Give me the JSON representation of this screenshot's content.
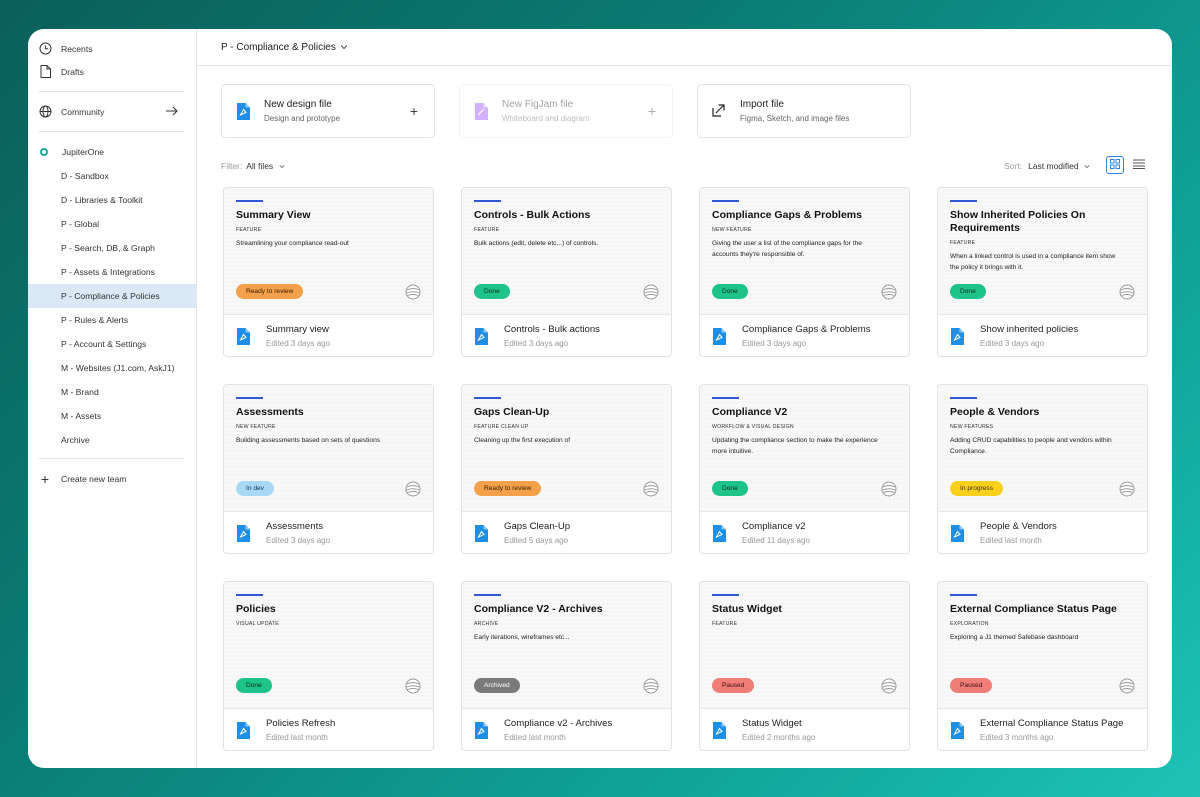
{
  "sidebar": {
    "recents": "Recents",
    "drafts": "Drafts",
    "community": "Community",
    "team": "JupiterOne",
    "projects": [
      "D - Sandbox",
      "D - Libraries & Toolkit",
      "P - Global",
      "P - Search, DB, & Graph",
      "P - Assets & Integrations",
      "P - Compliance & Policies",
      "P - Rules & Alerts",
      "P - Account & Settings",
      "M - Websites (J1.com, AskJ1)",
      "M - Brand",
      "M - Assets",
      "Archive"
    ],
    "active_project": "P - Compliance & Policies",
    "create_team": "Create new team"
  },
  "header": {
    "title": "P - Compliance & Policies"
  },
  "create": {
    "design": {
      "title": "New design file",
      "sub": "Design and prototype"
    },
    "figjam": {
      "title": "New FigJam file",
      "sub": "Whiteboard and diagram"
    },
    "import": {
      "title": "Import file",
      "sub": "Figma, Sketch, and image files"
    }
  },
  "filter": {
    "label": "Filter:",
    "value": "All files"
  },
  "sort": {
    "label": "Sort:",
    "value": "Last modified"
  },
  "colors": {
    "accent": "#2e86de",
    "brand_bar": "#3457d5",
    "ready_to_review": "#f5a04a",
    "done": "#1ec38a",
    "in_dev": "#a9d8f5",
    "in_progress": "#f9d11d",
    "archived": "#7a7a7a",
    "paused": "#f07d78",
    "file_icon": "#1f8fe5"
  },
  "files": [
    {
      "title": "Summary View",
      "tag": "FEATURE",
      "desc": "Streamlining your compliance read-out",
      "status": "Ready to review",
      "status_color": "#f5a04a",
      "status_text_color": "#3a2100",
      "name": "Summary view",
      "edited": "Edited 3 days ago"
    },
    {
      "title": "Controls - Bulk Actions",
      "tag": "FEATURE",
      "desc": "Bulk actions (edit, delete etc...) of controls.",
      "status": "Done",
      "status_color": "#1ec38a",
      "status_text_color": "#0b2d20",
      "name": "Controls - Bulk actions",
      "edited": "Edited 3 days ago"
    },
    {
      "title": "Compliance Gaps & Problems",
      "tag": "NEW FEATURE",
      "desc": "Giving the user a list of the compliance gaps for the accounts they're responsible of.",
      "status": "Done",
      "status_color": "#1ec38a",
      "status_text_color": "#0b2d20",
      "name": "Compliance Gaps & Problems",
      "edited": "Edited 3 days ago"
    },
    {
      "title": "Show Inherited Policies On Requirements",
      "tag": "FEATURE",
      "desc": "When a linked control is used in a compliance item show the policy it brings with it.",
      "status": "Done",
      "status_color": "#1ec38a",
      "status_text_color": "#0b2d20",
      "name": "Show inherited policies",
      "edited": "Edited 3 days ago"
    },
    {
      "title": "Assessments",
      "tag": "NEW FEATURE",
      "desc": "Building assessments based on sets of questions",
      "status": "In dev",
      "status_color": "#a9d8f5",
      "status_text_color": "#0f3350",
      "name": "Assessments",
      "edited": "Edited 3 days ago"
    },
    {
      "title": "Gaps Clean-Up",
      "tag": "FEATURE CLEAN UP",
      "desc": "Cleaning up the first execution of",
      "status": "Ready to review",
      "status_color": "#f5a04a",
      "status_text_color": "#3a2100",
      "name": "Gaps Clean-Up",
      "edited": "Edited 5 days ago"
    },
    {
      "title": "Compliance V2",
      "tag": "WORKFLOW & VISUAL DESIGN",
      "desc": "Updating the compliance section to make the experience more intuitive.",
      "status": "Done",
      "status_color": "#1ec38a",
      "status_text_color": "#0b2d20",
      "name": "Compliance v2",
      "edited": "Edited 11 days ago"
    },
    {
      "title": "People & Vendors",
      "tag": "NEW FEATURES",
      "desc": "Adding CRUD capabilities to people and vendors within Compliance.",
      "status": "In progress",
      "status_color": "#f9d11d",
      "status_text_color": "#3a3000",
      "name": "People & Vendors",
      "edited": "Edited last month"
    },
    {
      "title": "Policies",
      "tag": "VISUAL UPDATE",
      "desc": "",
      "status": "Done",
      "status_color": "#1ec38a",
      "status_text_color": "#0b2d20",
      "name": "Policies Refresh",
      "edited": "Edited last month"
    },
    {
      "title": "Compliance V2 - Archives",
      "tag": "ARCHIVE",
      "desc": "Early iterations, wireframes etc...",
      "status": "Archived",
      "status_color": "#7a7a7a",
      "status_text_color": "#ffffff",
      "name": "Compliance v2 - Archives",
      "edited": "Edited last month"
    },
    {
      "title": "Status Widget",
      "tag": "FEATURE",
      "desc": "",
      "status": "Paused",
      "status_color": "#f07d78",
      "status_text_color": "#3a0e0c",
      "name": "Status Widget",
      "edited": "Edited 2 months ago"
    },
    {
      "title": "External Compliance Status Page",
      "tag": "EXPLORATION",
      "desc": "Exploring a J1 themed Safebase dashboard",
      "status": "Paused",
      "status_color": "#f07d78",
      "status_text_color": "#3a0e0c",
      "name": "External Compliance Status Page",
      "edited": "Edited 3 months ago"
    }
  ]
}
